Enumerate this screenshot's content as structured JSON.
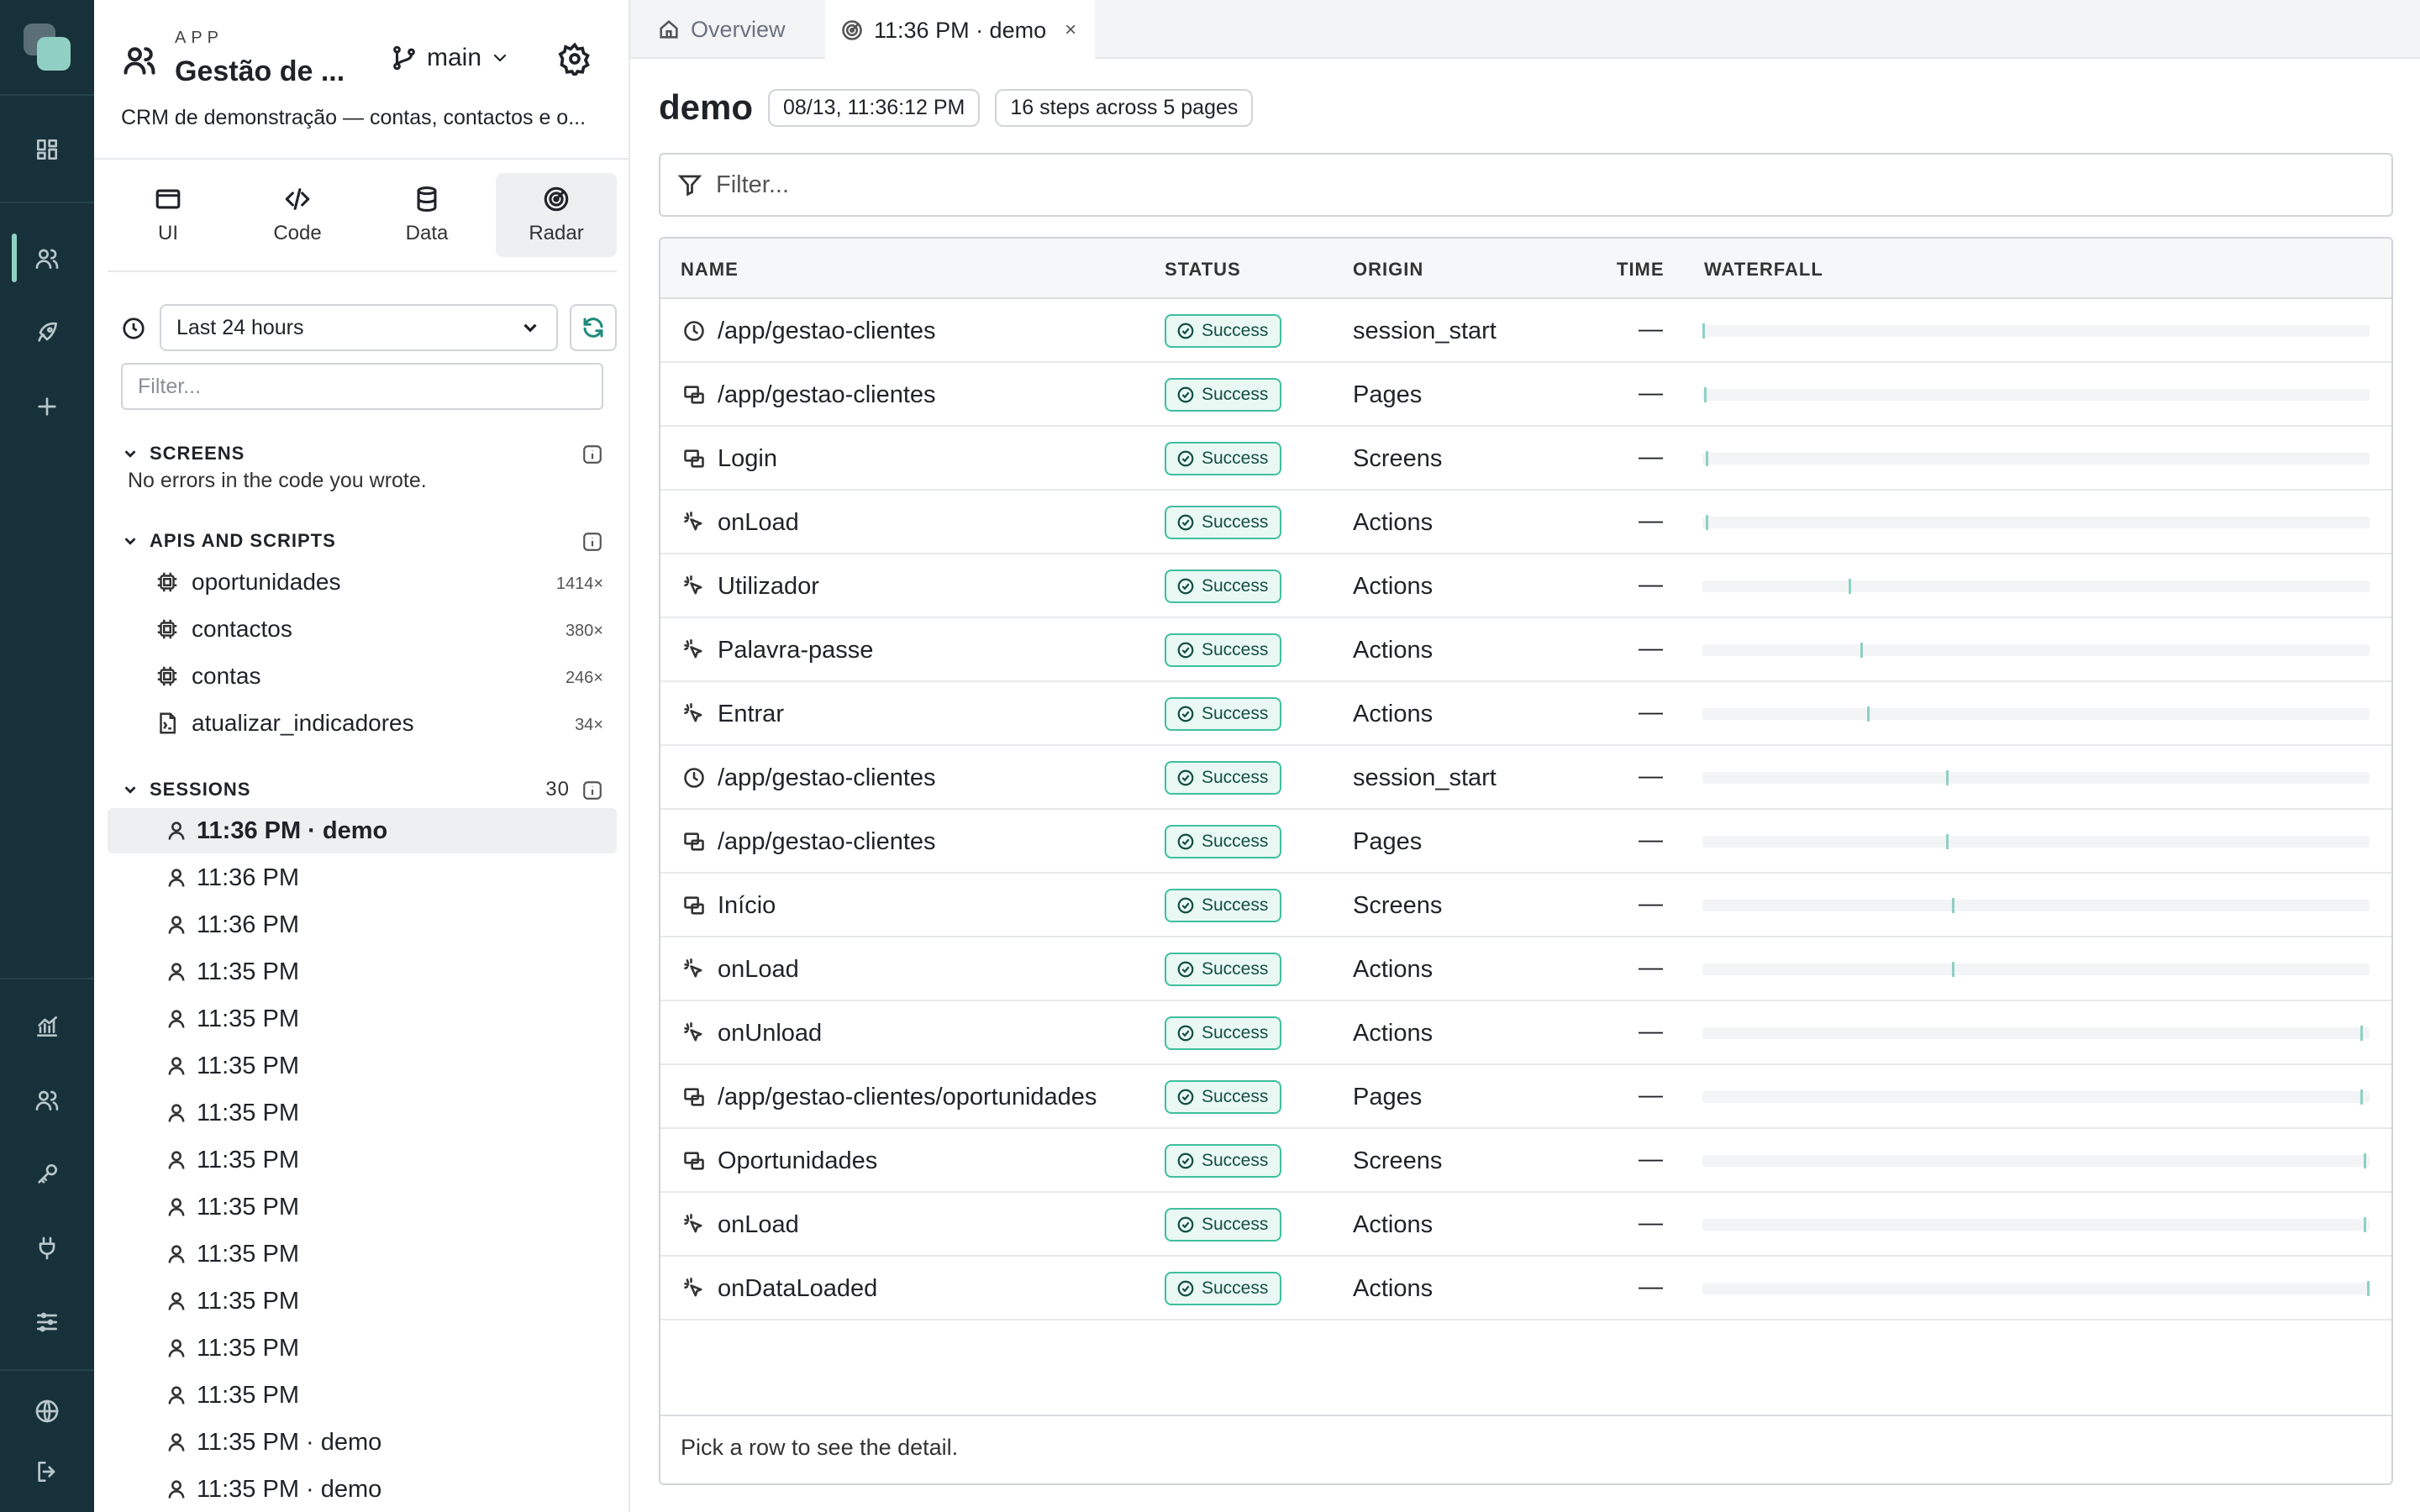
{
  "rail": {
    "icons": [
      "dashboard-icon",
      "users-icon",
      "rocket-icon",
      "plus-icon",
      "analytics-icon",
      "team-icon",
      "key-icon",
      "plug-icon",
      "sliders-icon",
      "globe-icon",
      "logout-icon"
    ]
  },
  "app": {
    "kicker": "APP",
    "title": "Gestão de ...",
    "branch": "main",
    "description": "CRM de demonstração — contas, contactos e o..."
  },
  "modes": [
    {
      "label": "UI",
      "icon": "window-icon"
    },
    {
      "label": "Code",
      "icon": "code-icon"
    },
    {
      "label": "Data",
      "icon": "database-icon"
    },
    {
      "label": "Radar",
      "icon": "radar-icon"
    }
  ],
  "range": {
    "value": "Last 24 hours"
  },
  "sidebar_filter": {
    "placeholder": "Filter..."
  },
  "screens": {
    "title": "SCREENS",
    "note": "No errors in the code you wrote."
  },
  "apis": {
    "title": "APIS AND SCRIPTS",
    "items": [
      {
        "name": "oportunidades",
        "count": "1414×",
        "icon": "chip-icon"
      },
      {
        "name": "contactos",
        "count": "380×",
        "icon": "chip-icon"
      },
      {
        "name": "contas",
        "count": "246×",
        "icon": "chip-icon"
      },
      {
        "name": "atualizar_indicadores",
        "count": "34×",
        "icon": "script-icon"
      }
    ]
  },
  "sessions": {
    "title": "SESSIONS",
    "count": "30",
    "items": [
      "11:36 PM · demo",
      "11:36 PM",
      "11:36 PM",
      "11:35 PM",
      "11:35 PM",
      "11:35 PM",
      "11:35 PM",
      "11:35 PM",
      "11:35 PM",
      "11:35 PM",
      "11:35 PM",
      "11:35 PM",
      "11:35 PM",
      "11:35 PM · demo",
      "11:35 PM · demo"
    ]
  },
  "tabs": [
    {
      "label": "Overview",
      "icon": "home-icon"
    },
    {
      "label": "11:36 PM · demo",
      "icon": "radar-icon",
      "close": "×"
    }
  ],
  "session": {
    "title": "demo",
    "timestamp": "08/13, 11:36:12 PM",
    "summary": "16 steps across 5 pages"
  },
  "main_filter": {
    "placeholder": "Filter..."
  },
  "table": {
    "columns": [
      "NAME",
      "STATUS",
      "ORIGIN",
      "TIME",
      "WATERFALL"
    ],
    "rows": [
      {
        "icon": "clock-icon",
        "name": "/app/gestao-clientes",
        "status": "Success",
        "origin": "session_start",
        "time": "—",
        "waterfall": 0.0
      },
      {
        "icon": "pages-icon",
        "name": "/app/gestao-clientes",
        "status": "Success",
        "origin": "Pages",
        "time": "—",
        "waterfall": 0.003
      },
      {
        "icon": "pages-icon",
        "name": "Login",
        "status": "Success",
        "origin": "Screens",
        "time": "—",
        "waterfall": 0.005
      },
      {
        "icon": "action-icon",
        "name": "onLoad",
        "status": "Success",
        "origin": "Actions",
        "time": "—",
        "waterfall": 0.005
      },
      {
        "icon": "action-icon",
        "name": "Utilizador",
        "status": "Success",
        "origin": "Actions",
        "time": "—",
        "waterfall": 0.22
      },
      {
        "icon": "action-icon",
        "name": "Palavra-passe",
        "status": "Success",
        "origin": "Actions",
        "time": "—",
        "waterfall": 0.238
      },
      {
        "icon": "action-icon",
        "name": "Entrar",
        "status": "Success",
        "origin": "Actions",
        "time": "—",
        "waterfall": 0.248
      },
      {
        "icon": "clock-icon",
        "name": "/app/gestao-clientes",
        "status": "Success",
        "origin": "session_start",
        "time": "—",
        "waterfall": 0.366
      },
      {
        "icon": "pages-icon",
        "name": "/app/gestao-clientes",
        "status": "Success",
        "origin": "Pages",
        "time": "—",
        "waterfall": 0.366
      },
      {
        "icon": "pages-icon",
        "name": "Início",
        "status": "Success",
        "origin": "Screens",
        "time": "—",
        "waterfall": 0.376
      },
      {
        "icon": "action-icon",
        "name": "onLoad",
        "status": "Success",
        "origin": "Actions",
        "time": "—",
        "waterfall": 0.376
      },
      {
        "icon": "action-icon",
        "name": "onUnload",
        "status": "Success",
        "origin": "Actions",
        "time": "—",
        "waterfall": 0.99
      },
      {
        "icon": "pages-icon",
        "name": "/app/gestao-clientes/oportunidades",
        "status": "Success",
        "origin": "Pages",
        "time": "—",
        "waterfall": 0.99
      },
      {
        "icon": "pages-icon",
        "name": "Oportunidades",
        "status": "Success",
        "origin": "Screens",
        "time": "—",
        "waterfall": 0.995
      },
      {
        "icon": "action-icon",
        "name": "onLoad",
        "status": "Success",
        "origin": "Actions",
        "time": "—",
        "waterfall": 0.995
      },
      {
        "icon": "action-icon",
        "name": "onDataLoaded",
        "status": "Success",
        "origin": "Actions",
        "time": "—",
        "waterfall": 1.0
      }
    ]
  },
  "detail_hint": "Pick a row to see the detail."
}
